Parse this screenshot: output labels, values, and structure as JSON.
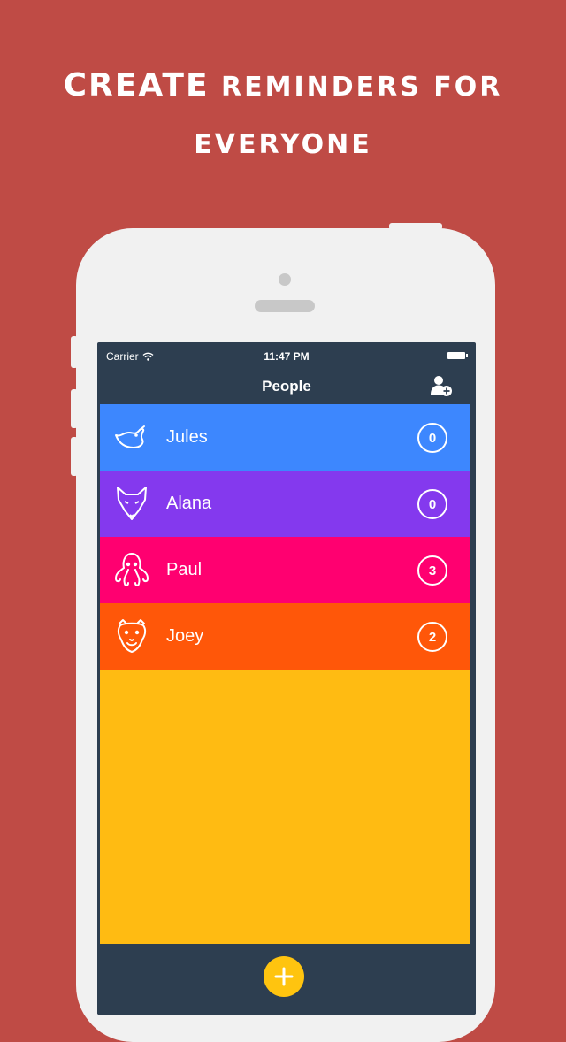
{
  "promo": {
    "line1_emphasis": "CREATE",
    "line1_rest": "REMINDERS FOR",
    "line2": "EVERYONE"
  },
  "status_bar": {
    "carrier": "Carrier",
    "time": "11:47 PM"
  },
  "nav": {
    "title": "People",
    "add_icon": "add-person-icon"
  },
  "people": [
    {
      "name": "Jules",
      "count": "0",
      "color": "#3d87fe",
      "icon": "bird-icon"
    },
    {
      "name": "Alana",
      "count": "0",
      "color": "#8439ee",
      "icon": "fox-icon"
    },
    {
      "name": "Paul",
      "count": "3",
      "color": "#ff0070",
      "icon": "octopus-icon"
    },
    {
      "name": "Joey",
      "count": "2",
      "color": "#ff5709",
      "icon": "camel-icon"
    }
  ],
  "colors": {
    "background": "#bf4b45",
    "empty_area": "#ffbb12",
    "bar": "#2d3e50",
    "fab": "#ffc40f"
  },
  "fab_icon": "plus-icon"
}
